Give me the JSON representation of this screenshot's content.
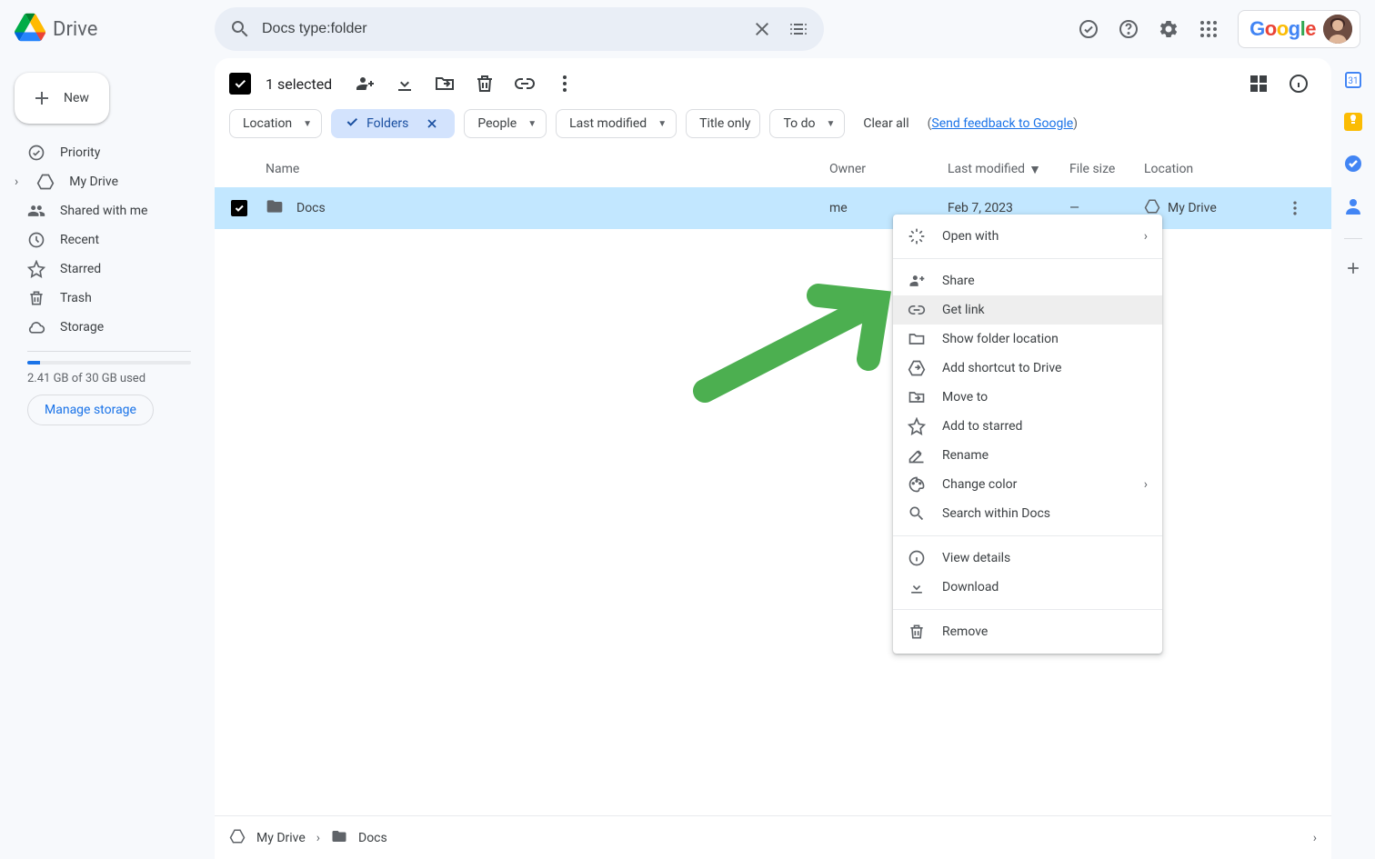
{
  "app": {
    "name": "Drive"
  },
  "search": {
    "value": "Docs type:folder"
  },
  "sidebar": {
    "new_label": "New",
    "items": [
      {
        "label": "Priority"
      },
      {
        "label": "My Drive"
      },
      {
        "label": "Shared with me"
      },
      {
        "label": "Recent"
      },
      {
        "label": "Starred"
      },
      {
        "label": "Trash"
      },
      {
        "label": "Storage"
      }
    ],
    "storage_text": "2.41 GB of 30 GB used",
    "storage_pct": 8,
    "manage_label": "Manage storage"
  },
  "toolbar": {
    "selected_text": "1 selected"
  },
  "chips": {
    "location": "Location",
    "folders": "Folders",
    "people": "People",
    "last_modified": "Last modified",
    "title_only": "Title only",
    "to_do": "To do",
    "clear": "Clear all",
    "feedback_prefix": "(",
    "feedback_link": "Send feedback to Google",
    "feedback_suffix": ")"
  },
  "columns": {
    "name": "Name",
    "owner": "Owner",
    "modified": "Last modified",
    "size": "File size",
    "location": "Location"
  },
  "rows": [
    {
      "name": "Docs",
      "owner": "me",
      "modified": "Feb 7, 2023",
      "size": "—",
      "location": "My Drive"
    }
  ],
  "breadcrumb": {
    "root": "My Drive",
    "current": "Docs"
  },
  "context_menu": {
    "open_with": "Open with",
    "share": "Share",
    "get_link": "Get link",
    "show_location": "Show folder location",
    "add_shortcut": "Add shortcut to Drive",
    "move_to": "Move to",
    "add_starred": "Add to starred",
    "rename": "Rename",
    "change_color": "Change color",
    "search_within": "Search within Docs",
    "view_details": "View details",
    "download": "Download",
    "remove": "Remove"
  }
}
